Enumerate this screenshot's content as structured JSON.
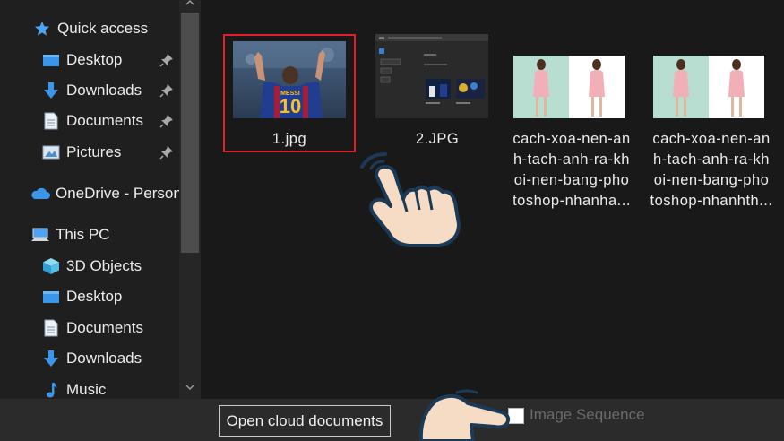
{
  "sidebar": {
    "items": [
      {
        "label": "Quick access",
        "icon": "star-icon"
      },
      {
        "label": "Desktop",
        "icon": "desktop-folder-icon",
        "pinned": true
      },
      {
        "label": "Downloads",
        "icon": "download-arrow-icon",
        "pinned": true
      },
      {
        "label": "Documents",
        "icon": "documents-icon",
        "pinned": true
      },
      {
        "label": "Pictures",
        "icon": "pictures-icon",
        "pinned": true
      },
      {
        "label": "OneDrive - Person",
        "icon": "cloud-icon"
      },
      {
        "label": "This PC",
        "icon": "computer-icon"
      },
      {
        "label": "3D Objects",
        "icon": "cube-icon"
      },
      {
        "label": "Desktop",
        "icon": "desktop-folder-icon"
      },
      {
        "label": "Documents",
        "icon": "documents-icon"
      },
      {
        "label": "Downloads",
        "icon": "download-arrow-icon"
      },
      {
        "label": "Music",
        "icon": "music-note-icon"
      }
    ]
  },
  "files": [
    {
      "name": "1.jpg",
      "selected": true
    },
    {
      "name": "2.JPG"
    },
    {
      "name_lines": [
        "cach-xoa-nen-an",
        "h-tach-anh-ra-kh",
        "oi-nen-bang-pho",
        "toshop-nhanha..."
      ]
    },
    {
      "name_lines": [
        "cach-xoa-nen-an",
        "h-tach-anh-ra-kh",
        "oi-nen-bang-pho",
        "toshop-nhanhth..."
      ]
    }
  ],
  "thumb1": {
    "jersey_text": "10",
    "jersey_label": "MESSI"
  },
  "bottom": {
    "cloud_button": "Open cloud documents",
    "image_sequence_label": "Image Sequence",
    "image_sequence_checked": false
  },
  "colors": {
    "selection_border": "#e01f26",
    "hand_fill": "#f6dcc4",
    "hand_outline": "#1b3a57"
  }
}
